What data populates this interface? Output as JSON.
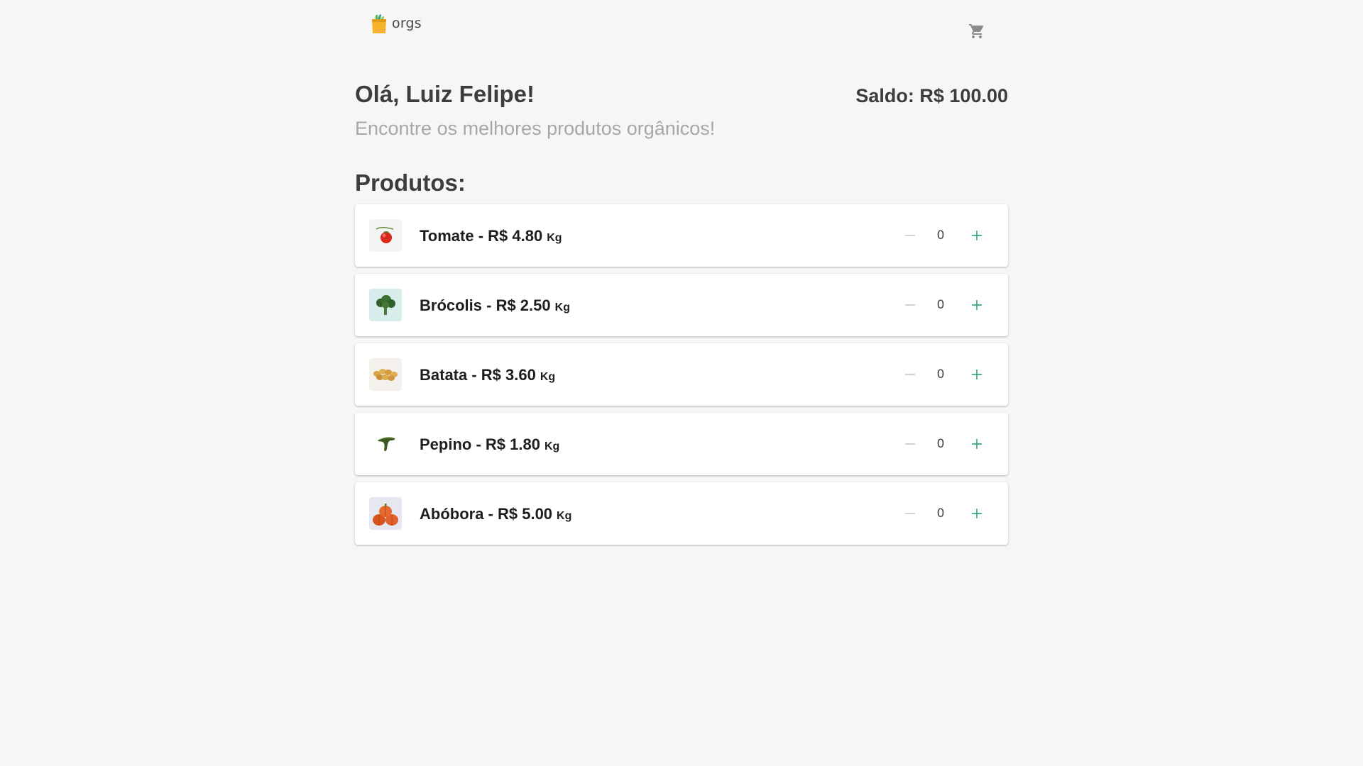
{
  "header": {
    "logo_text": "orgs",
    "logo_icon": "shopping-bag-icon",
    "cart_icon": "shopping-cart-icon"
  },
  "main": {
    "greeting": "Olá, Luiz Felipe!",
    "balance": "Saldo: R$ 100.00",
    "subtitle": "Encontre os melhores produtos orgânicos!",
    "products_heading": "Produtos:"
  },
  "products": [
    {
      "name": "Tomate - R$ 4.80",
      "unit": "Kg",
      "quantity": "0",
      "image": "tomato-image"
    },
    {
      "name": "Brócolis - R$ 2.50",
      "unit": "Kg",
      "quantity": "0",
      "image": "broccoli-image"
    },
    {
      "name": "Batata - R$ 3.60",
      "unit": "Kg",
      "quantity": "0",
      "image": "potato-image"
    },
    {
      "name": "Pepino - R$ 1.80",
      "unit": "Kg",
      "quantity": "0",
      "image": "cucumber-image"
    },
    {
      "name": "Abóbora - R$ 5.00",
      "unit": "Kg",
      "quantity": "0",
      "image": "pumpkin-image"
    }
  ],
  "colors": {
    "background": "#f6f6f6",
    "accent": "#2a9f85",
    "disabled": "#bdbdbd",
    "text": "#464646",
    "subtitle": "#a7a7a7"
  }
}
